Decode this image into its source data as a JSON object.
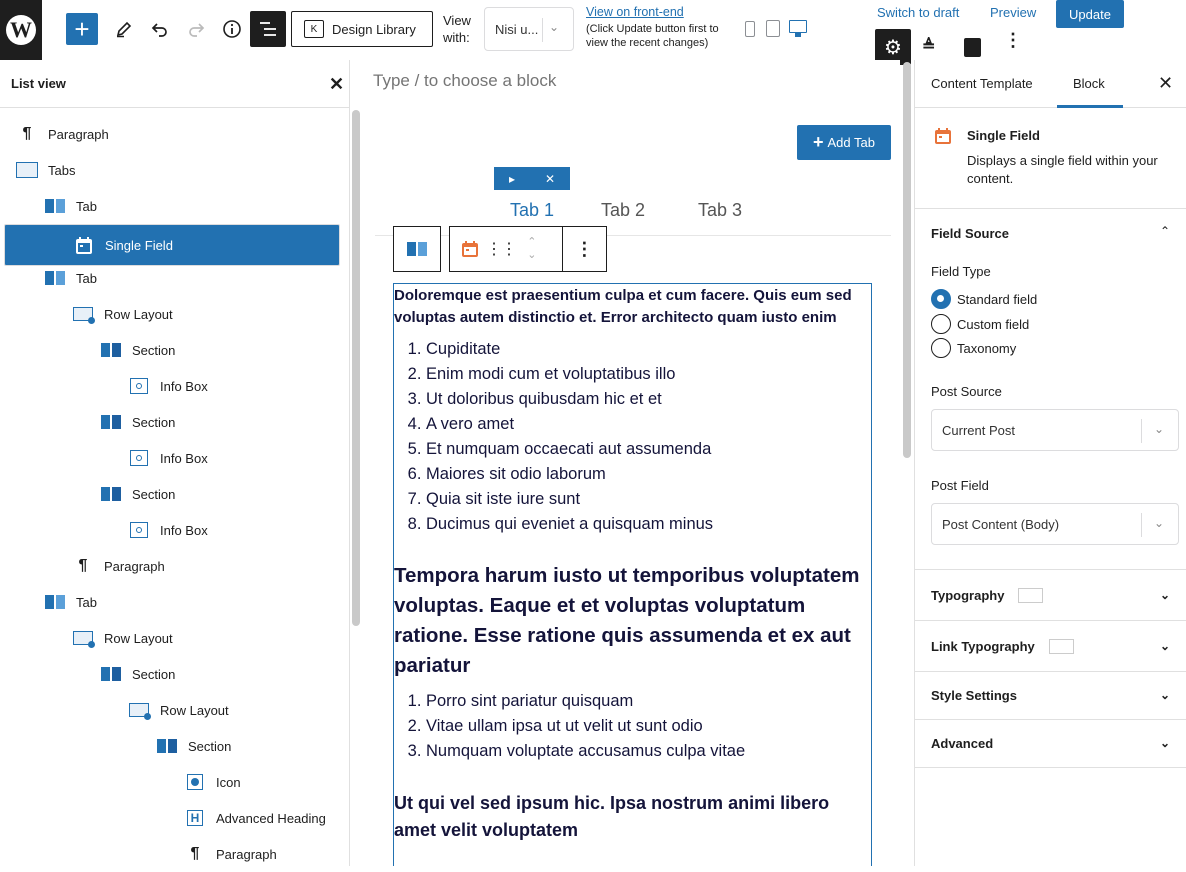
{
  "topbar": {
    "view_with_label": "View with:",
    "view_select_value": "Nisi u...",
    "front_end_link": "View on front-end",
    "front_end_note": "(Click Update button first to view the recent changes)",
    "design_library_label": "Design Library",
    "switch_draft": "Switch to draft",
    "preview": "Preview",
    "update": "Update"
  },
  "list_view": {
    "title": "List view",
    "items": [
      {
        "label": "Paragraph",
        "icon": "paragraph-icon",
        "level": 0
      },
      {
        "label": "Tabs",
        "icon": "tabs-icon",
        "level": 0
      },
      {
        "label": "Tab",
        "icon": "tab-icon",
        "level": 1
      },
      {
        "label": "Single Field",
        "icon": "calendar-icon",
        "level": 2,
        "selected": true
      },
      {
        "label": "Tab",
        "icon": "tab-icon",
        "level": 1
      },
      {
        "label": "Row Layout",
        "icon": "row-layout-icon",
        "level": 2
      },
      {
        "label": "Section",
        "icon": "section-icon",
        "level": 3
      },
      {
        "label": "Info Box",
        "icon": "info-box-icon",
        "level": 4
      },
      {
        "label": "Section",
        "icon": "section-icon",
        "level": 3
      },
      {
        "label": "Info Box",
        "icon": "info-box-icon",
        "level": 4
      },
      {
        "label": "Section",
        "icon": "section-icon",
        "level": 3
      },
      {
        "label": "Info Box",
        "icon": "info-box-icon",
        "level": 4
      },
      {
        "label": "Paragraph",
        "icon": "paragraph-icon",
        "level": 2
      },
      {
        "label": "Tab",
        "icon": "tab-icon",
        "level": 1
      },
      {
        "label": "Row Layout",
        "icon": "row-layout-icon",
        "level": 2
      },
      {
        "label": "Section",
        "icon": "section-icon",
        "level": 3
      },
      {
        "label": "Row Layout",
        "icon": "row-layout-icon",
        "level": 4
      },
      {
        "label": "Section",
        "icon": "section-icon",
        "level": 5
      },
      {
        "label": "Icon",
        "icon": "icon-block-icon",
        "level": 6
      },
      {
        "label": "Advanced Heading",
        "icon": "heading-icon",
        "level": 6
      },
      {
        "label": "Paragraph",
        "icon": "paragraph-icon",
        "level": 6
      }
    ]
  },
  "canvas": {
    "placeholder": "Type / to choose a block",
    "add_tab": "Add Tab",
    "tabs": [
      "Tab 1",
      "Tab 2",
      "Tab 3"
    ],
    "intro": "Doloremque est praesentium culpa et cum facere. Quis eum sed voluptas autem distinctio et. Error architecto quam iusto enim",
    "list1": [
      "Cupiditate",
      "Enim modi cum et voluptatibus illo",
      "Ut doloribus quibusdam hic et et",
      "A vero amet",
      "Et numquam occaecati aut assumenda",
      "Maiores sit odio laborum",
      "Quia sit iste iure sunt",
      "Ducimus qui eveniet a quisquam minus"
    ],
    "heading2": "Tempora harum iusto ut temporibus voluptatem voluptas. Eaque et et voluptas voluptatum ratione. Esse ratione quis assumenda et ex aut pariatur",
    "list2": [
      "Porro sint pariatur quisquam",
      "Vitae ullam ipsa ut ut velit ut sunt odio",
      "Numquam voluptate accusamus culpa vitae"
    ],
    "heading3": "Ut qui vel sed ipsum hic. Ipsa nostrum animi libero amet velit voluptatem"
  },
  "sidebar": {
    "tab_content_template": "Content Template",
    "tab_block": "Block",
    "block_name": "Single Field",
    "block_desc": "Displays a single field within your content.",
    "field_source": {
      "title": "Field Source",
      "field_type_label": "Field Type",
      "options": [
        "Standard field",
        "Custom field",
        "Taxonomy"
      ],
      "selected_option": "Standard field",
      "post_source_label": "Post Source",
      "post_source_value": "Current Post",
      "post_field_label": "Post Field",
      "post_field_value": "Post Content (Body)"
    },
    "panels": [
      "Typography",
      "Link Typography",
      "Style Settings",
      "Advanced"
    ]
  },
  "colors": {
    "accent": "#2271b1",
    "dark": "#1e1e1e",
    "field_icon": "#e8733a"
  }
}
